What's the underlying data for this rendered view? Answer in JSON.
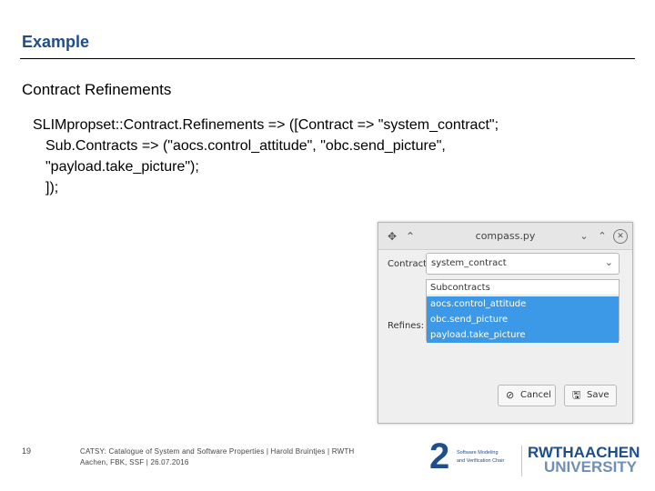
{
  "slide": {
    "title": "Example",
    "heading": "Contract Refinements",
    "code_lines": [
      "SLIMpropset::Contract.Refinements => ([Contract => \"system_contract\";",
      "Sub.Contracts => (\"aocs.control_attitude\", \"obc.send_picture\",",
      "\"payload.take_picture\");",
      "]);"
    ]
  },
  "dialog": {
    "window_title": "compass.py",
    "contract_label": "Contract:",
    "contract_value": "system_contract",
    "refines_label": "Refines:",
    "list_header": "Subcontracts",
    "list_items": [
      "aocs.control_attitude",
      "obc.send_picture",
      "payload.take_picture"
    ],
    "cancel_label": "Cancel",
    "save_label": "Save",
    "selection_color": "#3b99e8"
  },
  "footer": {
    "page_number": "19",
    "text_line1": "CATSY: Catalogue of System and Software Properties  |  Harold Bruintjes  |  RWTH",
    "text_line2": "Aachen, FBK, SSF  |  26.07.2016",
    "logo_se_mark": "2",
    "logo_se_line1": "Software Modeling",
    "logo_se_line2": "and Verification Chair",
    "logo_rwth_line1": "RWTHAACHEN",
    "logo_rwth_line2": "UNIVERSITY"
  }
}
